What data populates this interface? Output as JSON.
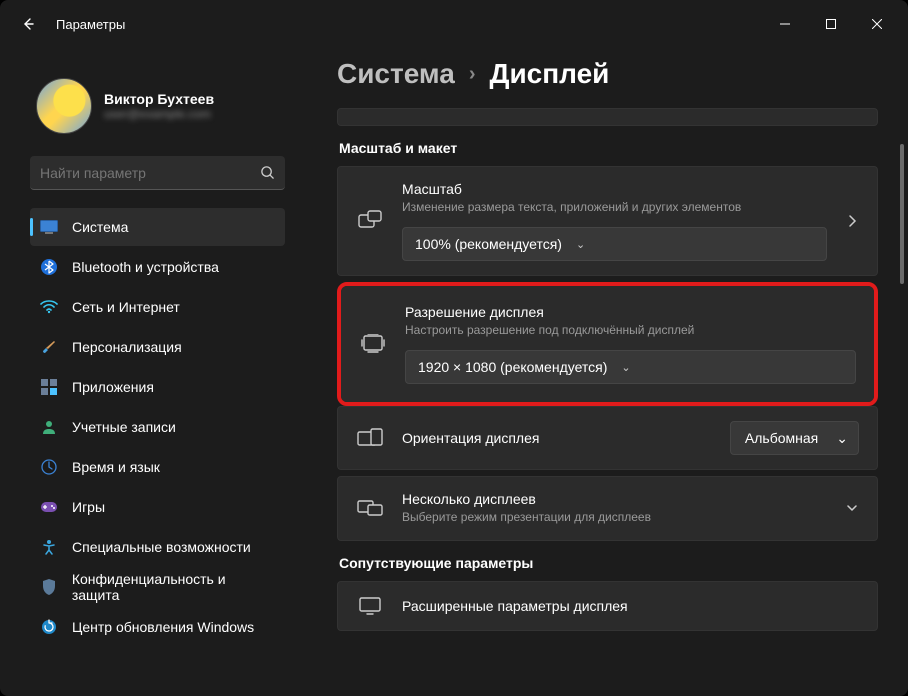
{
  "window": {
    "title": "Параметры"
  },
  "profile": {
    "name": "Виктор Бухтеев",
    "email": "user@example.com"
  },
  "search": {
    "placeholder": "Найти параметр"
  },
  "nav": {
    "items": [
      {
        "label": "Система"
      },
      {
        "label": "Bluetooth и устройства"
      },
      {
        "label": "Сеть и Интернет"
      },
      {
        "label": "Персонализация"
      },
      {
        "label": "Приложения"
      },
      {
        "label": "Учетные записи"
      },
      {
        "label": "Время и язык"
      },
      {
        "label": "Игры"
      },
      {
        "label": "Специальные возможности"
      },
      {
        "label": "Конфиденциальность и защита"
      },
      {
        "label": "Центр обновления Windows"
      }
    ]
  },
  "breadcrumb": {
    "root": "Система",
    "current": "Дисплей"
  },
  "sections": {
    "scale_layout": "Масштаб и макет",
    "related": "Сопутствующие параметры"
  },
  "cards": {
    "scale": {
      "title": "Масштаб",
      "desc": "Изменение размера текста, приложений и других элементов",
      "value": "100% (рекомендуется)"
    },
    "resolution": {
      "title": "Разрешение дисплея",
      "desc": "Настроить разрешение под подключённый дисплей",
      "value": "1920 × 1080 (рекомендуется)"
    },
    "orientation": {
      "title": "Ориентация дисплея",
      "value": "Альбомная"
    },
    "multiple": {
      "title": "Несколько дисплеев",
      "desc": "Выберите режим презентации для дисплеев"
    },
    "advanced": {
      "title": "Расширенные параметры дисплея"
    }
  }
}
